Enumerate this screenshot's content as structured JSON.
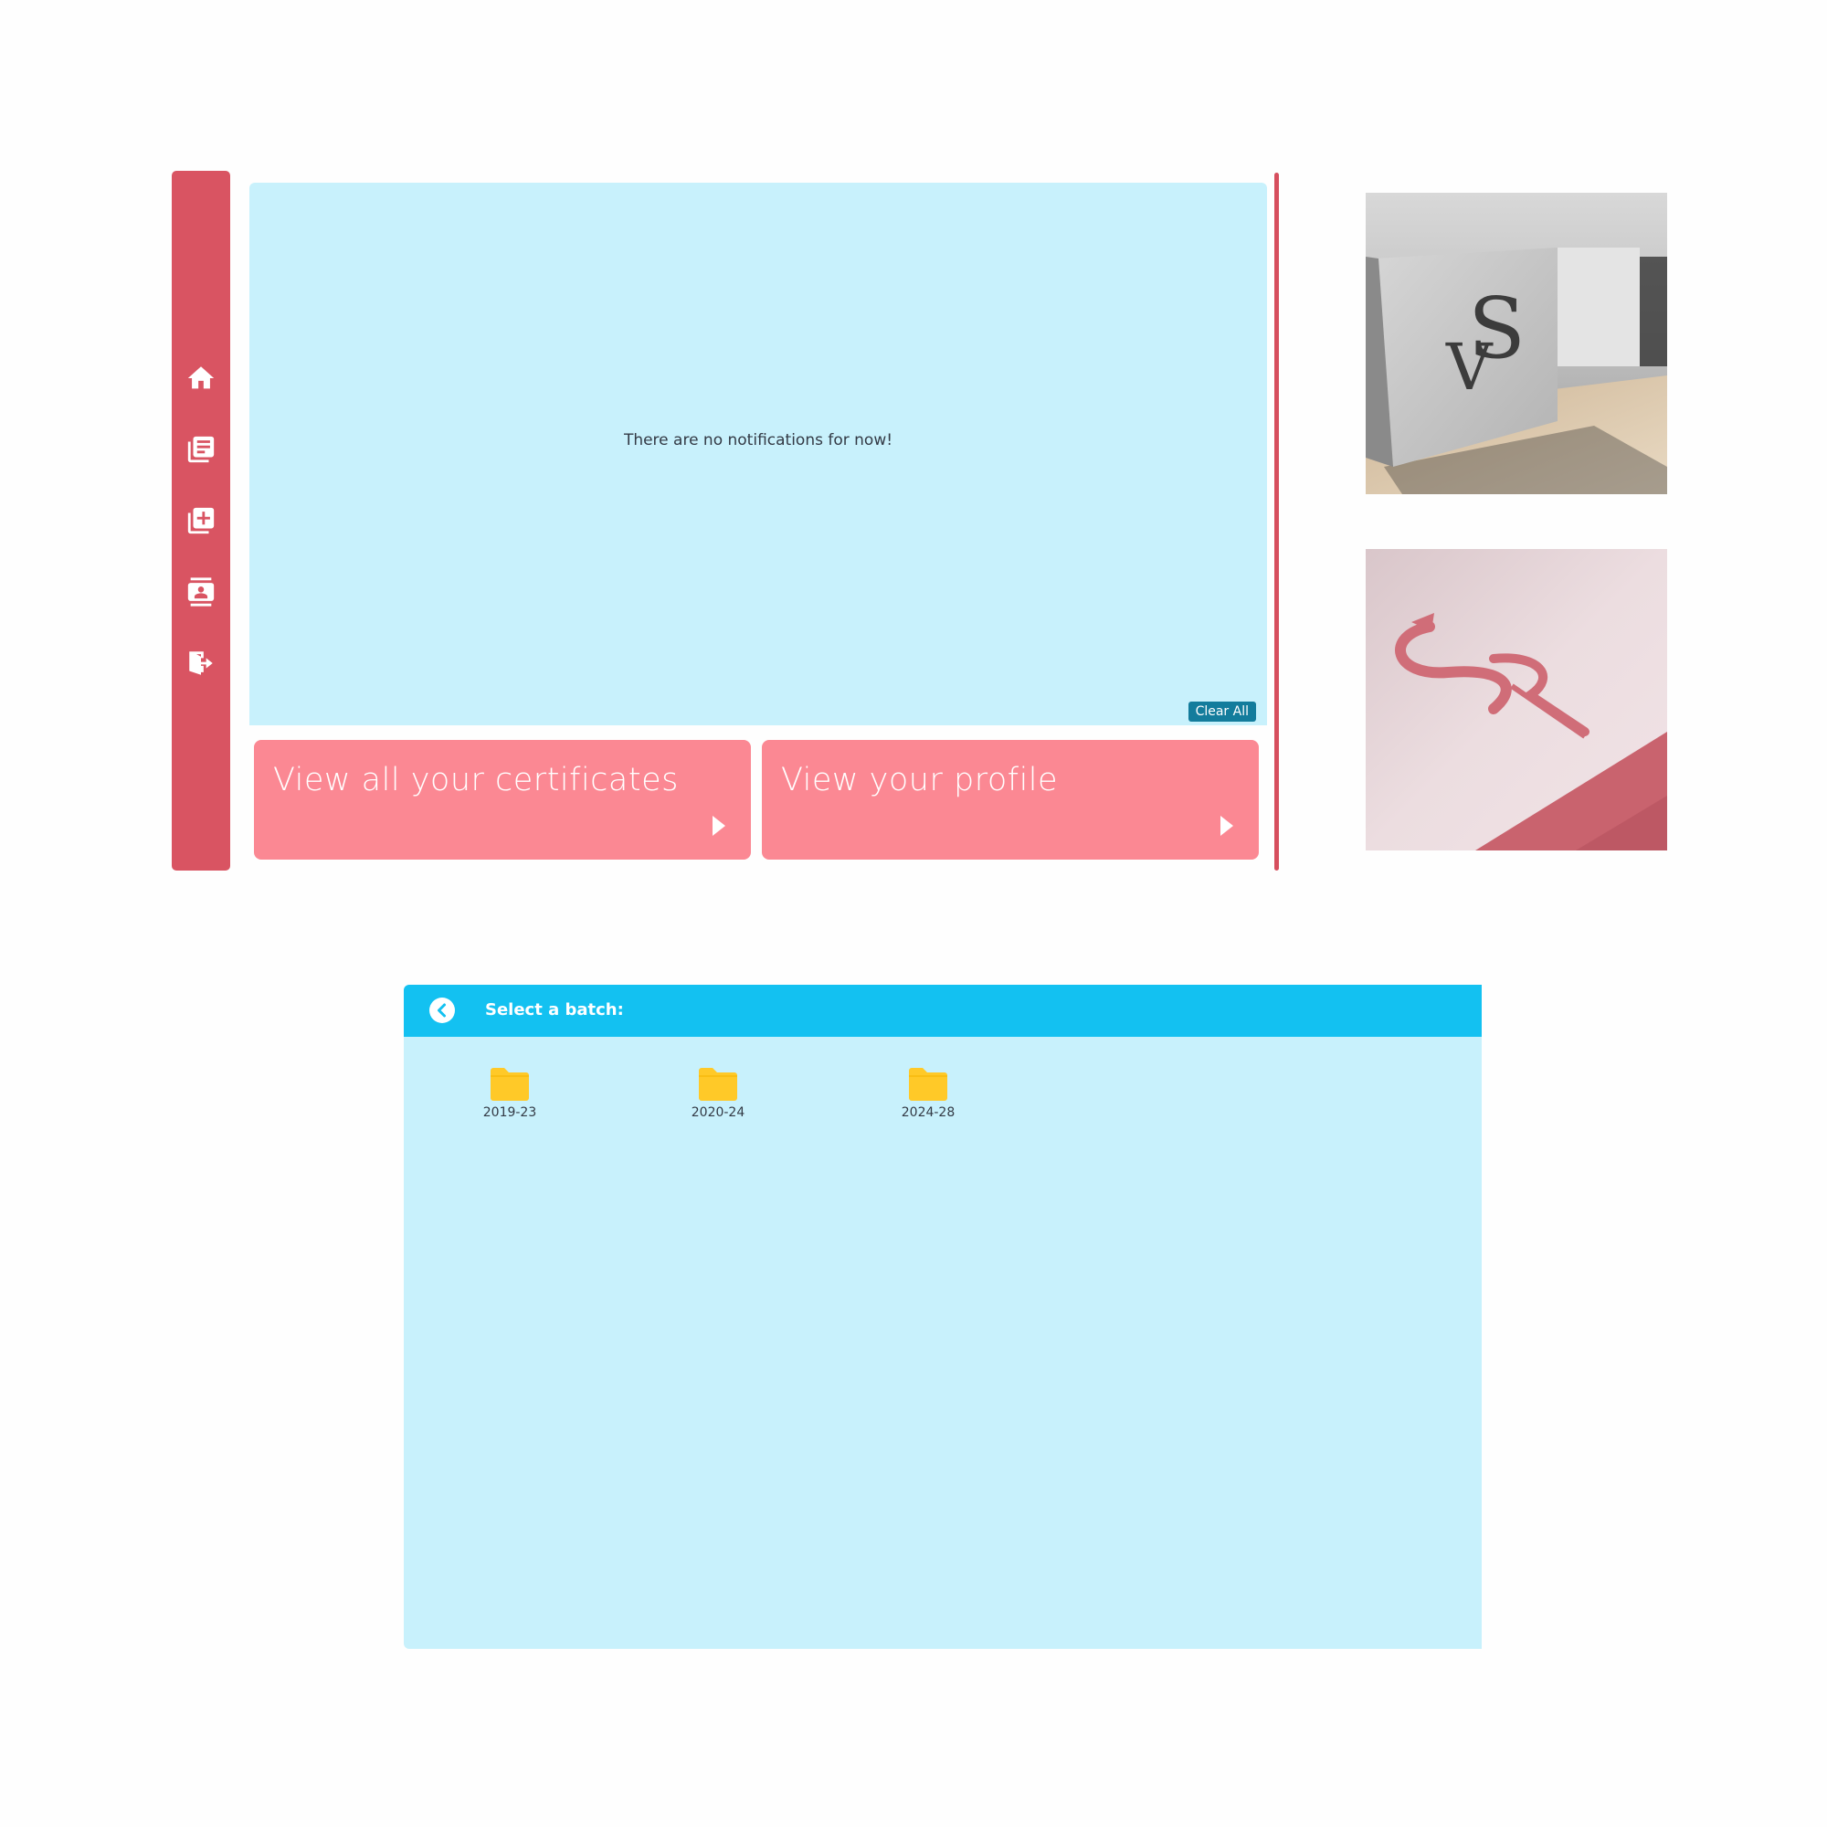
{
  "sidebar": {
    "items": [
      {
        "name": "home-icon"
      },
      {
        "name": "certificates-list-icon"
      },
      {
        "name": "add-certificate-icon"
      },
      {
        "name": "profile-card-icon"
      },
      {
        "name": "logout-icon"
      }
    ]
  },
  "notifications": {
    "empty_message": "There are no notifications for now!",
    "clear_label": "Clear All"
  },
  "cards": [
    {
      "title": "View all your certificates",
      "icon": "play-arrow-icon"
    },
    {
      "title": "View your profile",
      "icon": "play-arrow-icon"
    }
  ],
  "batch": {
    "title": "Select a batch:",
    "back_icon": "back-chevron-icon",
    "folders": [
      {
        "label": "2019-23"
      },
      {
        "label": "2020-24"
      },
      {
        "label": "2024-28"
      }
    ]
  },
  "colors": {
    "sidebar": "#d95462",
    "panel": "#c8f1fc",
    "card": "#fb8893",
    "header": "#13c1f1",
    "folder": "#ffc928",
    "clear_button": "#137c9c"
  }
}
